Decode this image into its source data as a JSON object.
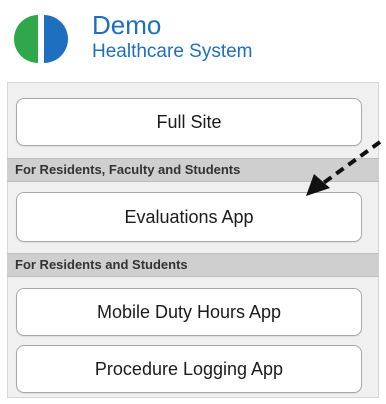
{
  "logo": {
    "title": "Demo",
    "subtitle": "Healthcare System",
    "colors": {
      "green": "#2ea84a",
      "blue": "#1f6fbf"
    }
  },
  "buttons": {
    "full_site": "Full Site",
    "evaluations": "Evaluations App",
    "duty_hours": "Mobile Duty Hours App",
    "procedure_logging": "Procedure Logging App"
  },
  "sections": {
    "residents_faculty_students": "For Residents, Faculty and Students",
    "residents_students": "For Residents and Students"
  },
  "annotation": {
    "icon": "dashed-arrow-icon"
  }
}
